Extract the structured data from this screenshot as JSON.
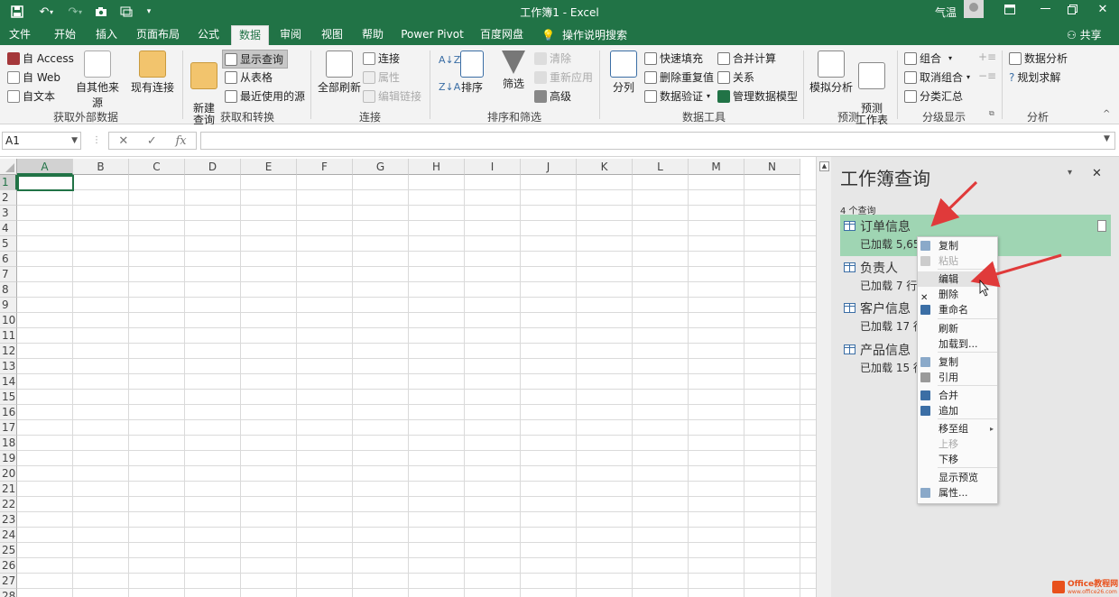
{
  "window": {
    "title": "工作簿1  -  Excel",
    "user_name": "气温",
    "controls": [
      "ribbon-display-icon",
      "minimize-icon",
      "restore-icon",
      "close-icon"
    ]
  },
  "quick_access": {
    "icons": [
      "save-icon",
      "undo-icon",
      "redo-icon",
      "camera-icon",
      "form-icon",
      "customize-icon"
    ]
  },
  "ribbon_tabs": [
    "文件",
    "开始",
    "插入",
    "页面布局",
    "公式",
    "数据",
    "审阅",
    "视图",
    "帮助",
    "Power Pivot",
    "百度网盘"
  ],
  "active_tab": "数据",
  "tell_me": "操作说明搜索",
  "share_label": "共享",
  "ribbon": {
    "get_external": {
      "access": "自 Access",
      "web": "自 Web",
      "text": "自文本",
      "other": "自其他来源",
      "existing": "现有连接",
      "group": "获取外部数据"
    },
    "get_transform": {
      "new_query": "新建\n查询",
      "show_queries": "显示查询",
      "from_table": "从表格",
      "recent": "最近使用的源",
      "group": "获取和转换"
    },
    "connections": {
      "refresh_all": "全部刷新",
      "connections": "连接",
      "properties": "属性",
      "edit_links": "编辑链接",
      "group": "连接"
    },
    "sort_filter": {
      "sort": "排序",
      "filter": "筛选",
      "clear": "清除",
      "reapply": "重新应用",
      "advanced": "高级",
      "group": "排序和筛选"
    },
    "data_tools": {
      "text_to_columns": "分列",
      "flash_fill": "快速填充",
      "remove_dup": "删除重复值",
      "validation": "数据验证",
      "consolidate": "合并计算",
      "relationships": "关系",
      "manage_model": "管理数据模型",
      "group": "数据工具"
    },
    "forecast": {
      "whatif": "模拟分析",
      "sheet": "预测\n工作表",
      "group": "预测"
    },
    "outline": {
      "group_btn": "组合",
      "ungroup": "取消组合",
      "subtotal": "分类汇总",
      "group": "分级显示"
    },
    "analysis": {
      "data_analysis": "数据分析",
      "solver": "规划求解",
      "group": "分析"
    }
  },
  "formula_bar": {
    "name_box": "A1",
    "cancel": "✕",
    "enter": "✓",
    "fx": "fx",
    "value": ""
  },
  "sheet": {
    "columns": [
      "A",
      "B",
      "C",
      "D",
      "E",
      "F",
      "G",
      "H",
      "I",
      "J",
      "K",
      "L",
      "M",
      "N"
    ],
    "rows": [
      "1",
      "2",
      "3",
      "4",
      "5",
      "6",
      "7",
      "8",
      "9",
      "10",
      "11",
      "12",
      "13",
      "14",
      "15",
      "16",
      "17",
      "18",
      "19",
      "20",
      "21",
      "22",
      "23",
      "24",
      "25",
      "26",
      "27",
      "28"
    ],
    "selected_cell": "A1"
  },
  "query_pane": {
    "title": "工作簿查询",
    "count": "4 个查询",
    "queries": [
      {
        "name": "订单信息",
        "status": "已加载 5,650"
      },
      {
        "name": "负责人",
        "status": "已加载 7 行"
      },
      {
        "name": "客户信息",
        "status": "已加载 17 行"
      },
      {
        "name": "产品信息",
        "status": "已加载 15 行"
      }
    ]
  },
  "context_menu": {
    "items": [
      {
        "label": "复制",
        "icon": "copy-icon",
        "disabled": false
      },
      {
        "label": "粘贴",
        "icon": "paste-icon",
        "disabled": true
      },
      {
        "label": "编辑",
        "icon": "",
        "disabled": false
      },
      {
        "label": "删除",
        "icon": "delete-icon",
        "disabled": false
      },
      {
        "label": "重命名",
        "icon": "rename-icon",
        "disabled": false
      },
      {
        "label": "刷新",
        "icon": "",
        "disabled": false
      },
      {
        "label": "加载到...",
        "icon": "",
        "disabled": false
      },
      {
        "label": "复制",
        "icon": "duplicate-icon",
        "disabled": false
      },
      {
        "label": "引用",
        "icon": "reference-icon",
        "disabled": false
      },
      {
        "label": "合并",
        "icon": "merge-icon",
        "disabled": false
      },
      {
        "label": "追加",
        "icon": "append-icon",
        "disabled": false
      },
      {
        "label": "移至组",
        "icon": "",
        "disabled": false
      },
      {
        "label": "上移",
        "icon": "",
        "disabled": true
      },
      {
        "label": "下移",
        "icon": "",
        "disabled": false
      },
      {
        "label": "显示预览",
        "icon": "",
        "disabled": false
      },
      {
        "label": "属性...",
        "icon": "properties-icon",
        "disabled": false
      }
    ],
    "hovered": "编辑"
  },
  "watermark": {
    "line1": "Office教程网",
    "line2": "www.office26.com"
  },
  "colors": {
    "excel_green": "#217346",
    "selected_query": "#9fd5b3",
    "pane_bg": "#e7e7e7",
    "annotation_arrow": "#e03a3a"
  }
}
